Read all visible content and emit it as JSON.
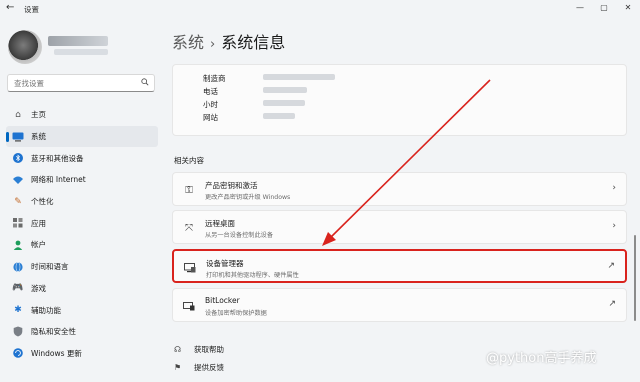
{
  "window": {
    "title": "设置",
    "controls": [
      "—",
      "▢",
      "✕"
    ]
  },
  "search": {
    "placeholder": "查找设置"
  },
  "sidebar": {
    "items": [
      {
        "label": "主页",
        "icon": "home-icon",
        "active": false
      },
      {
        "label": "系统",
        "icon": "system-icon",
        "active": true
      },
      {
        "label": "蓝牙和其他设备",
        "icon": "bluetooth-icon",
        "active": false
      },
      {
        "label": "网络和 Internet",
        "icon": "wifi-icon",
        "active": false
      },
      {
        "label": "个性化",
        "icon": "pen-icon",
        "active": false
      },
      {
        "label": "应用",
        "icon": "apps-icon",
        "active": false
      },
      {
        "label": "帐户",
        "icon": "person-icon",
        "active": false
      },
      {
        "label": "时间和语言",
        "icon": "globe-icon",
        "active": false
      },
      {
        "label": "游戏",
        "icon": "game-icon",
        "active": false
      },
      {
        "label": "辅助功能",
        "icon": "accessibility-icon",
        "active": false
      },
      {
        "label": "隐私和安全性",
        "icon": "shield-icon",
        "active": false
      },
      {
        "label": "Windows 更新",
        "icon": "update-icon",
        "active": false
      }
    ]
  },
  "header": {
    "parent": "系统",
    "separator": "›",
    "title": "系统信息"
  },
  "info": {
    "rows": [
      {
        "label": "制造商"
      },
      {
        "label": "电话"
      },
      {
        "label": "小时"
      },
      {
        "label": "网站"
      }
    ]
  },
  "related": {
    "title": "相关内容",
    "cards": [
      {
        "title": "产品密钥和激活",
        "subtitle": "更改产品密钥或升级 Windows",
        "icon": "key-icon",
        "action": "›"
      },
      {
        "title": "远程桌面",
        "subtitle": "从另一台设备控制此设备",
        "icon": "remote-desktop-icon",
        "action": "›"
      },
      {
        "title": "设备管理器",
        "subtitle": "打印机和其他驱动程序、硬件属性",
        "icon": "device-manager-icon",
        "action": "↗"
      },
      {
        "title": "BitLocker",
        "subtitle": "设备加密帮助保护数据",
        "icon": "bitlocker-icon",
        "action": "↗"
      }
    ]
  },
  "help_links": [
    {
      "label": "获取帮助",
      "icon": "help-icon"
    },
    {
      "label": "提供反馈",
      "icon": "feedback-icon"
    }
  ],
  "watermark": "@python高手养成",
  "colors": {
    "accent": "#0067c0",
    "highlight": "#d9231d"
  }
}
